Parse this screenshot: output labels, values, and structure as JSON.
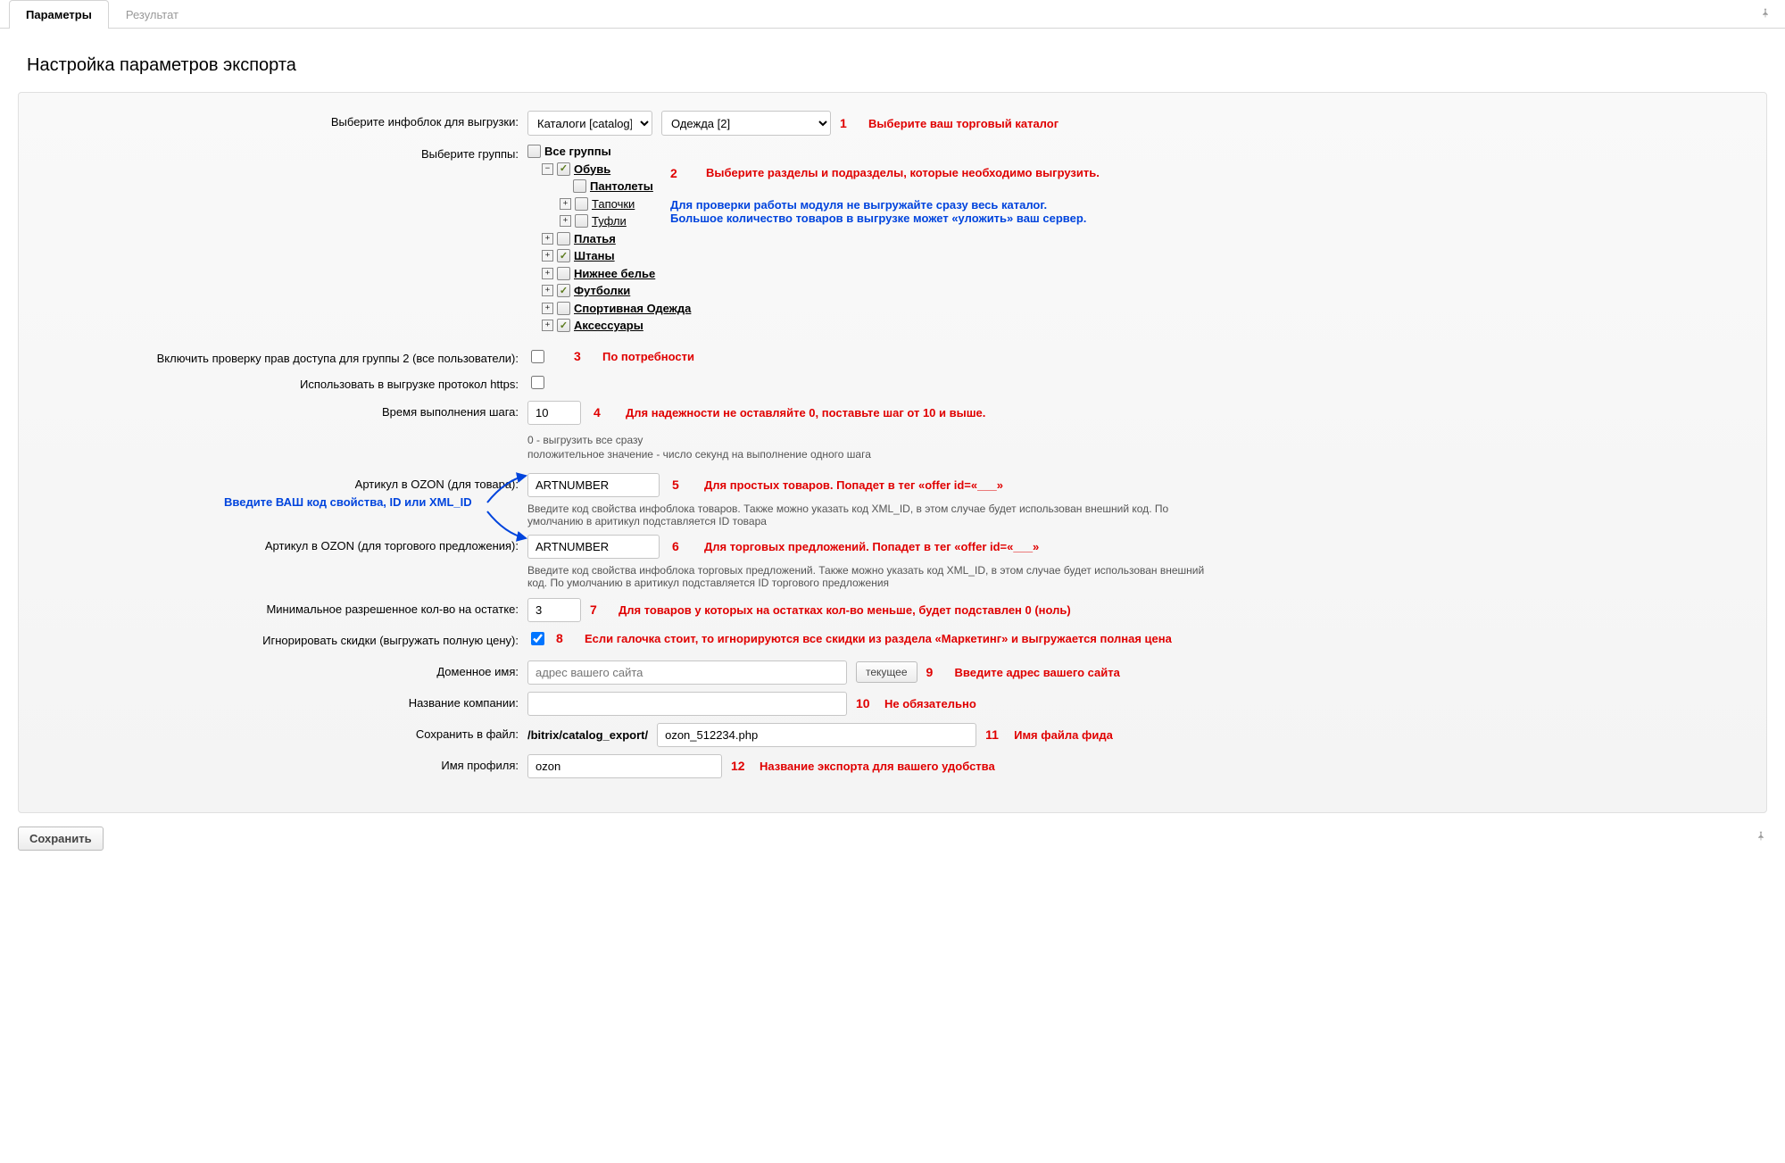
{
  "tabs": {
    "params": "Параметры",
    "result": "Результат"
  },
  "pageTitle": "Настройка параметров экспорта",
  "labels": {
    "infoblock": "Выберите инфоблок для выгрузки:",
    "groups": "Выберите группы:",
    "permCheck": "Включить проверку прав доступа для группы 2 (все пользователи):",
    "https": "Использовать в выгрузке протокол https:",
    "stepTime": "Время выполнения шага:",
    "artProduct": "Артикул в OZON (для товара):",
    "artOffer": "Артикул в OZON (для торгового предложения):",
    "minStock": "Минимальное разрешенное кол-во на остатке:",
    "ignoreDiscount": "Игнорировать скидки (выгружать полную цену):",
    "domain": "Доменное имя:",
    "company": "Название компании:",
    "saveFile": "Сохранить в файл:",
    "profileName": "Имя профиля:"
  },
  "selects": {
    "catalog": "Каталоги [catalog]",
    "iblock": "Одежда [2]"
  },
  "tree": {
    "root": "Все группы",
    "n1": "Обувь",
    "n1a": "Пантолеты",
    "n1b": "Тапочки",
    "n1c": "Туфли",
    "n2": "Платья",
    "n3": "Штаны",
    "n4": "Нижнее белье",
    "n5": "Футболки",
    "n6": "Спортивная Одежда",
    "n7": "Аксессуары"
  },
  "values": {
    "stepTime": "10",
    "artProduct": "ARTNUMBER",
    "artOffer": "ARTNUMBER",
    "minStock": "3",
    "domainPlaceholder": "адрес вашего сайта",
    "currentBtn": "текущее",
    "savePrefix": "/bitrix/catalog_export/",
    "saveFile": "ozon_512234.php",
    "profileName": "ozon"
  },
  "helpTexts": {
    "stepZero": "0 - выгрузить все сразу",
    "stepPositive": "положительное значение - число секунд на выполнение одного шага",
    "artProduct": "Введите код свойства инфоблока товаров. Также можно указать код XML_ID, в этом случае будет использован внешний код. По умолчанию в аритикул подставляется ID товара",
    "artOffer": "Введите код свойства инфоблока торговых предложений. Также можно указать код XML_ID, в этом случае будет использован внешний код. По умолчанию в аритикул подставляется ID торгового предложения"
  },
  "notes": {
    "n1": {
      "num": "1",
      "text": "Выберите ваш торговый каталог"
    },
    "n2": {
      "num": "2",
      "text": "Выберите разделы и подразделы, которые необходимо выгрузить."
    },
    "n2blue1": "Для проверки работы модуля не выгружайте сразу весь каталог.",
    "n2blue2": "Большое количество товаров в выгрузке может «уложить» ваш сервер.",
    "n3": {
      "num": "3",
      "text": "По потребности"
    },
    "n4": {
      "num": "4",
      "text": "Для надежности не оставляйте 0, поставьте шаг от 10 и выше."
    },
    "sideBlue": "Введите ВАШ код свойства, ID или XML_ID",
    "n5": {
      "num": "5",
      "text": "Для простых товаров. Попадет в тег «offer id=«___»"
    },
    "n6": {
      "num": "6",
      "text": "Для торговых предложений. Попадет в тег «offer id=«___»"
    },
    "n7": {
      "num": "7",
      "text": "Для товаров у которых на остатках кол-во меньше, будет подставлен 0 (ноль)"
    },
    "n8": {
      "num": "8",
      "text": "Если галочка стоит, то игнорируются все скидки из раздела «Маркетинг» и выгружается полная цена"
    },
    "n9": {
      "num": "9",
      "text": "Введите адрес вашего сайта"
    },
    "n10": {
      "num": "10",
      "text": "Не обязательно"
    },
    "n11": {
      "num": "11",
      "text": "Имя файла фида"
    },
    "n12": {
      "num": "12",
      "text": "Название экспорта для вашего удобства"
    }
  },
  "buttons": {
    "save": "Сохранить"
  }
}
